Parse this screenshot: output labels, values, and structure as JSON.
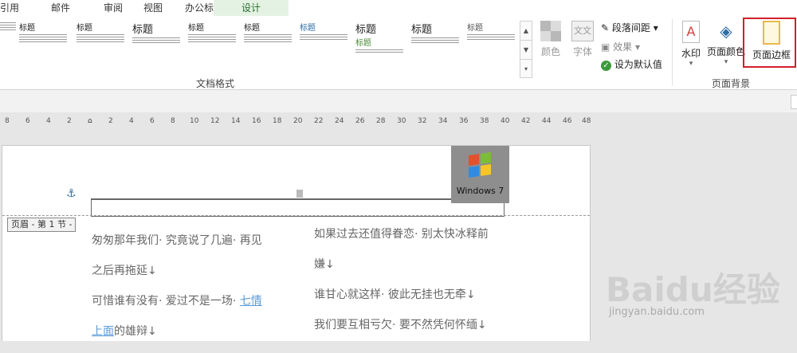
{
  "tabs": {
    "items": [
      "引用",
      "邮件",
      "审阅",
      "视图",
      "办公标签",
      "设计"
    ],
    "active": "设计"
  },
  "ribbon": {
    "styles_group_label": "文档格式",
    "style_titles": [
      "标题",
      "标题",
      "标题",
      "标题",
      "标题",
      "标题",
      "标题",
      "标题",
      "标题",
      "标题"
    ],
    "colors_label": "颜色",
    "fonts_label": "字体",
    "font_icon_text": "文文",
    "paragraph_spacing_label": "段落间距",
    "effects_label": "效果",
    "set_default_label": "设为默认值",
    "watermark_label": "水印",
    "page_color_label": "页面颜色",
    "page_border_label": "页面边框",
    "background_group_label": "页面背景"
  },
  "ruler": {
    "ticks": [
      "8",
      "6",
      "4",
      "2",
      "",
      "2",
      "4",
      "6",
      "8",
      "10",
      "12",
      "14",
      "16",
      "18",
      "20",
      "22",
      "24",
      "26",
      "28",
      "30",
      "32",
      "34",
      "36",
      "38",
      "40",
      "42",
      "44",
      "46",
      "48"
    ]
  },
  "document": {
    "header_label": "页眉 - 第 1 节 -",
    "header_image_text": "Windows 7",
    "left_column": {
      "line1": "匆匆那年我们· 究竟说了几遍· 再见",
      "line2": "之后再拖延↓",
      "line3_a": "可惜谁有没有· 爱过不是一场· ",
      "line3_link": "七情",
      "line4_link": "上面",
      "line4_b": "的雄辩↓"
    },
    "right_column": {
      "line1": "如果过去还值得眷恋· 别太快冰释前",
      "line2": "嫌↓",
      "line3": "谁甘心就这样· 彼此无挂也无牵↓",
      "line4": "我们要互相亏欠· 要不然凭何怀缅↓"
    }
  },
  "watermark": {
    "brand": "Baidu经验",
    "url": "jingyan.baidu.com"
  },
  "colors": {
    "active_tab_bg": "#e4f2e4",
    "highlight_border": "#d0202a",
    "link": "#5b9bd5"
  }
}
